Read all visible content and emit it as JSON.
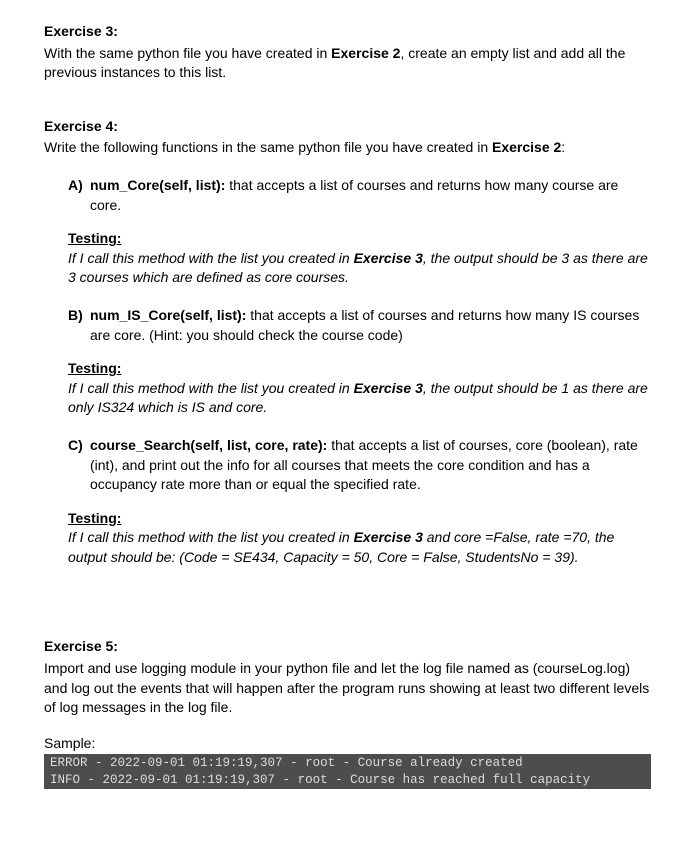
{
  "ex3": {
    "title": "Exercise 3:",
    "body_pre": "With the same python file you have created in ",
    "body_bold1": "Exercise 2",
    "body_post": ", create an empty list and add all the previous instances to this list."
  },
  "ex4": {
    "title": "Exercise 4:",
    "body_pre": "Write the following functions in the same python file you have created in ",
    "body_bold1": "Exercise 2",
    "body_post": ":",
    "items": [
      {
        "letter": "A)",
        "sig": "num_Core(self, list):",
        "desc": " that accepts a list of courses and returns how many course are core.",
        "testing_label": "Testing:",
        "testing_pre": "If I call this method with the list you created in ",
        "testing_bold": "Exercise 3",
        "testing_post": ", the output should be 3 as there are 3 courses which are defined as core courses."
      },
      {
        "letter": "B)",
        "sig": "num_IS_Core(self, list):",
        "desc": " that accepts a list of courses and returns how many IS courses are core. (Hint: you should check the course code)",
        "testing_label": "Testing:",
        "testing_pre": "If I call this method with the list you created in ",
        "testing_bold": "Exercise 3",
        "testing_post": ", the output should be 1 as there are only IS324 which is IS and core."
      },
      {
        "letter": "C)",
        "sig": "course_Search(self, list, core, rate):",
        "desc": " that accepts a list of courses, core (boolean), rate (int), and print out the info for all courses that meets the core condition and has a occupancy rate more than or equal the specified rate.",
        "testing_label": "Testing:",
        "testing_pre": "If I call this method with the list you created in ",
        "testing_bold": "Exercise 3",
        "testing_post": " and core =False, rate =70, the output should be: (Code = SE434, Capacity = 50, Core = False, StudentsNo = 39)."
      }
    ]
  },
  "ex5": {
    "title": "Exercise 5:",
    "body": "Import and use logging module in your python file and let the log file named as (courseLog.log) and log out the events that will happen after the program runs showing at least two different levels of log messages in the log file.",
    "sample_label": "Sample:",
    "console": [
      {
        "level": "ERROR",
        "sep1": " - ",
        "ts": "2022-09-01 01:19:19,307",
        "sep2": " - ",
        "name": "root",
        "sep3": " - ",
        "msg": "Course already created"
      },
      {
        "level": "INFO",
        "sep1": " - ",
        "ts": "2022-09-01 01:19:19,307",
        "sep2": " - ",
        "name": "root",
        "sep3": " - ",
        "msg": "Course has reached full capacity"
      }
    ]
  }
}
